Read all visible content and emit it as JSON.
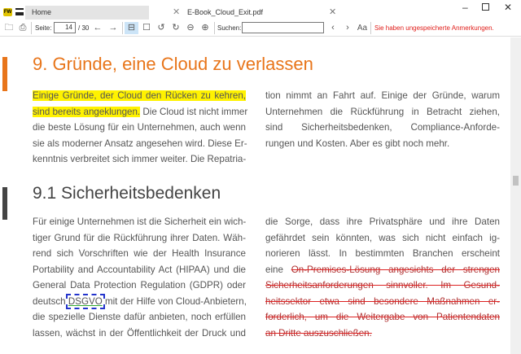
{
  "tabs": [
    {
      "label": "Home"
    },
    {
      "label": "E-Book_Cloud_Exit.pdf"
    }
  ],
  "toolbar": {
    "page_label": "Seite:",
    "page_current": "14",
    "page_total": "/ 30",
    "search_label": "Suchen:",
    "search_value": "",
    "warning": "Sie haben ungespeicherte Anmerkungen.",
    "warning_color": "#e0201c"
  },
  "doc": {
    "heading1": "9. Gründe, eine Cloud zu verlassen",
    "heading2": "9.1 Sicherheitsbedenken",
    "s1_col1": [
      "Einige Gründe, der Cloud den Rücken zu kehren,",
      "sind bereits angeklungen.",
      "Die Cloud ist nicht immer",
      "die beste Lösung für ein Unternehmen, auch wenn",
      "sie als moderner Ansatz angesehen wird. Diese Er-",
      "kenntnis verbreitet sich immer weiter. Die Repatria-"
    ],
    "s1_col2": [
      "tion nimmt an Fahrt auf. Einige der Gründe, warum",
      "Unternehmen die Rückführung in Betracht ziehen,",
      "sind Sicherheitsbedenken, Compliance-Anforde-",
      "rungen und Kosten. Aber es gibt noch mehr."
    ],
    "s2_col1": [
      "Für einige Unternehmen ist die Sicherheit ein wich-",
      "tiger Grund für die Rückführung ihrer Daten. Wäh-",
      "rend sich Vorschriften wie der Health Insurance",
      "Portability and Accountability Act (HIPAA) und die",
      "General Data Protection Regulation (GDPR) oder",
      "deutsch",
      "DSGVO",
      "mit der Hilfe von Cloud-Anbietern,",
      "die spezielle Dienste dafür anbieten, noch erfüllen",
      "lassen, wächst in der Öffentlichkeit der Druck und"
    ],
    "s2_col2": [
      "die Sorge, dass ihre Privatsphäre und ihre Daten",
      "gefährdet sein könnten, was sich nicht einfach ig-",
      "norieren lässt. In bestimmten Branchen erscheint",
      "eine",
      "On-Premises-Lösung angesichts der strengen",
      "Sicherheitsanforderungen sinnvoller. Im Gesund-",
      "heitssektor etwa sind besondere Maßnahmen er-",
      "forderlich, um die Weitergabe von Patientendaten",
      "an Dritte auszuschließen."
    ]
  }
}
